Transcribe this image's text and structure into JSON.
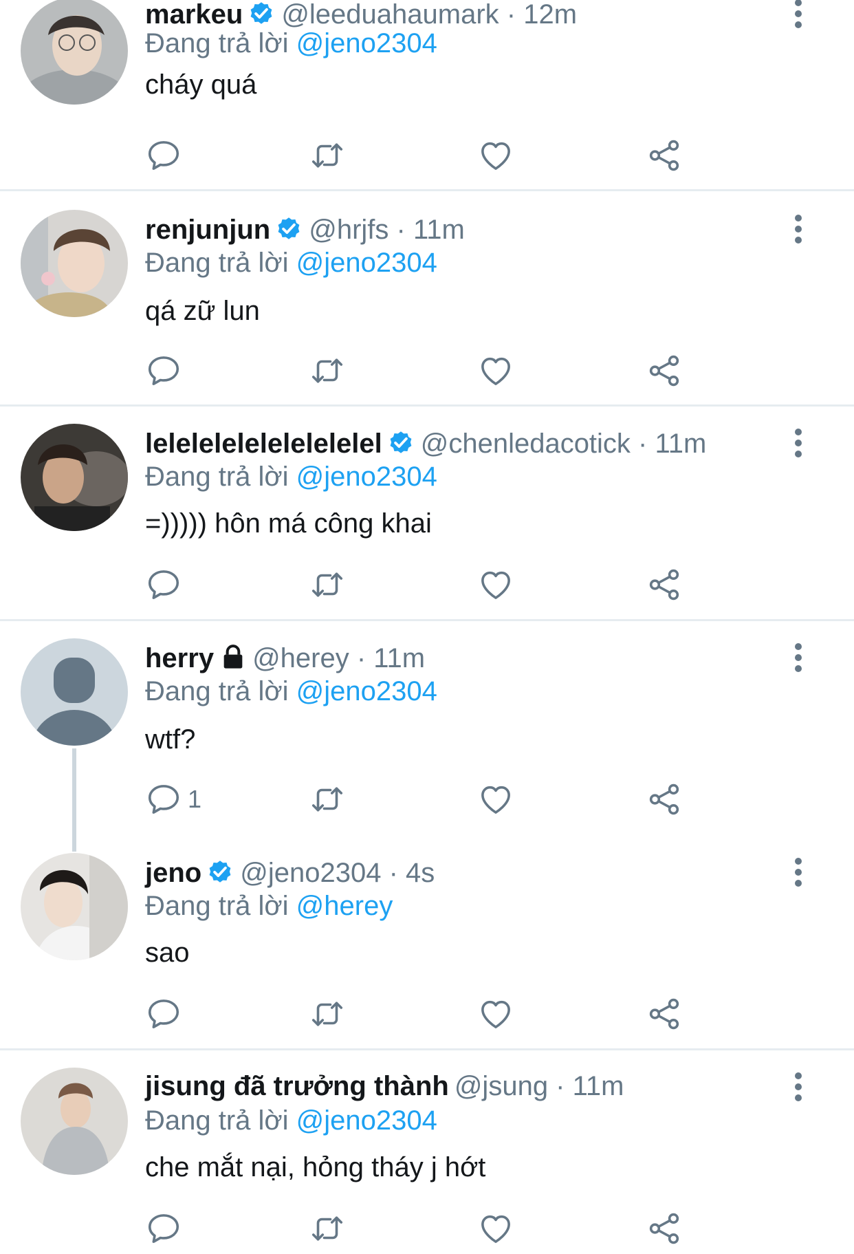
{
  "reply_prefix": "Đang trả lời",
  "tweets": [
    {
      "name": "markeu",
      "handle": "@leeduahaumark · 12m",
      "mention": "@jeno2304",
      "text": "cháy quá",
      "badge": "verified",
      "reply_count": "",
      "avatar": "avatar-markeu"
    },
    {
      "name": "renjunjun",
      "handle": "@hrjfs · 11m",
      "mention": "@jeno2304",
      "text": "qá zữ lun",
      "badge": "verified",
      "reply_count": "",
      "avatar": "avatar-renjunjun"
    },
    {
      "name": "lelelelelelelelelelel",
      "handle": "@chenledacotick · 11m",
      "mention": "@jeno2304",
      "text": "=))))) hôn má công khai",
      "badge": "verified",
      "reply_count": "",
      "avatar": "avatar-lelele"
    },
    {
      "name": "herry",
      "handle": "@herey · 11m",
      "mention": "@jeno2304",
      "text": "wtf?",
      "badge": "lock",
      "reply_count": "1",
      "avatar": "avatar-default"
    },
    {
      "name": "jeno",
      "handle": "@jeno2304 · 4s",
      "mention": "@herey",
      "text": "sao",
      "badge": "verified",
      "reply_count": "",
      "avatar": "avatar-jeno"
    },
    {
      "name": "jisung đã trưởng thành",
      "handle": "@jsung · 11m",
      "mention": "@jeno2304",
      "text": "che mắt nại, hỏng tháy j hớt",
      "badge": "none",
      "reply_count": "",
      "avatar": "avatar-jisung"
    }
  ],
  "colors": {
    "accent": "#1da1f2",
    "secondary_text": "#657786",
    "divider": "#e6ecf0"
  },
  "icons": [
    "reply-icon",
    "retweet-icon",
    "like-icon",
    "share-icon",
    "more-icon",
    "verified-badge-icon",
    "lock-icon"
  ]
}
